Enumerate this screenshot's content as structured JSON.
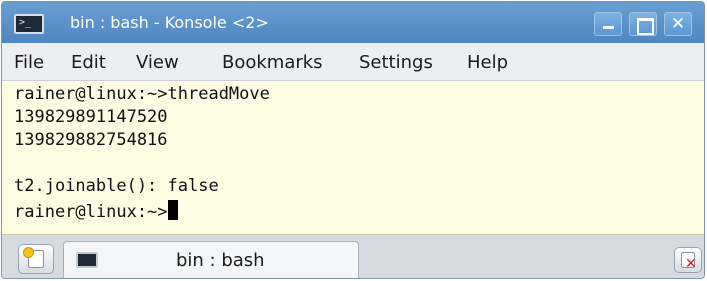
{
  "window": {
    "title": "bin : bash - Konsole <2>",
    "icons": {
      "app": "terminal-icon",
      "minimize": "minimize-icon",
      "maximize": "maximize-icon",
      "close": "close-icon",
      "close_glyph": "✕"
    }
  },
  "menu": {
    "items": [
      "File",
      "Edit",
      "View",
      "Bookmarks",
      "Settings",
      "Help"
    ]
  },
  "terminal": {
    "lines": [
      "rainer@linux:~>threadMove",
      "139829891147520",
      "139829882754816",
      "",
      "t2.joinable(): false",
      "rainer@linux:~>"
    ],
    "colors": {
      "background": "#fdfbe2",
      "text": "#111111"
    }
  },
  "tabbar": {
    "tabs": [
      {
        "label": "bin : bash",
        "icon": "terminal-icon"
      }
    ],
    "new_tab_icon": "new-tab-icon",
    "close_tab_icon": "close-tab-icon"
  },
  "colors": {
    "titlebar": "#5a92cb",
    "menubar": "#eceef0",
    "tabbar": "#d6dbe1"
  }
}
